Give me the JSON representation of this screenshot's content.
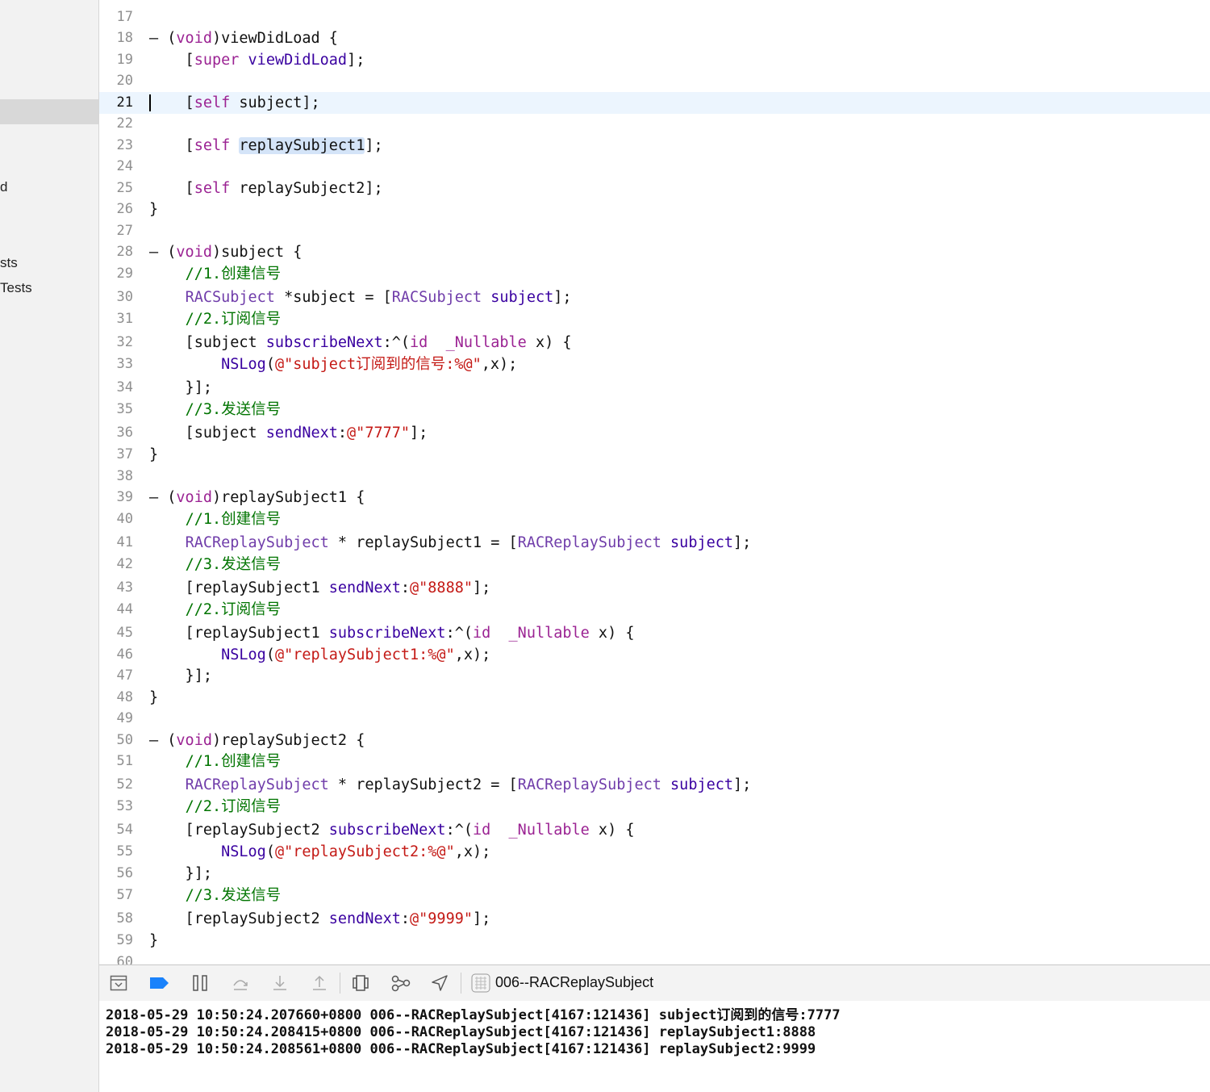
{
  "sidebar": {
    "items": [
      {
        "label": "d"
      },
      {
        "label": "sts"
      },
      {
        "label": "Tests"
      }
    ]
  },
  "editor": {
    "current_line": 21,
    "lines": [
      {
        "n": "17",
        "tokens": []
      },
      {
        "n": "18",
        "tokens": [
          {
            "t": "– ("
          },
          {
            "t": "void",
            "c": "kw"
          },
          {
            "t": ")viewDidLoad {"
          }
        ]
      },
      {
        "n": "19",
        "tokens": [
          {
            "t": "    ["
          },
          {
            "t": "super",
            "c": "kw"
          },
          {
            "t": " "
          },
          {
            "t": "viewDidLoad",
            "c": "m"
          },
          {
            "t": "];"
          }
        ]
      },
      {
        "n": "20",
        "tokens": []
      },
      {
        "n": "21",
        "tokens": [
          {
            "t": "    ["
          },
          {
            "t": "self",
            "c": "kw"
          },
          {
            "t": " subject];"
          }
        ]
      },
      {
        "n": "22",
        "tokens": []
      },
      {
        "n": "23",
        "tokens": [
          {
            "t": "    ["
          },
          {
            "t": "self",
            "c": "kw"
          },
          {
            "t": " "
          },
          {
            "t": "replaySubject1",
            "c": "hl"
          },
          {
            "t": "];"
          }
        ]
      },
      {
        "n": "24",
        "tokens": []
      },
      {
        "n": "25",
        "tokens": [
          {
            "t": "    ["
          },
          {
            "t": "self",
            "c": "kw"
          },
          {
            "t": " replaySubject2];"
          }
        ]
      },
      {
        "n": "26",
        "tokens": [
          {
            "t": "}"
          }
        ]
      },
      {
        "n": "27",
        "tokens": []
      },
      {
        "n": "28",
        "tokens": [
          {
            "t": "– ("
          },
          {
            "t": "void",
            "c": "kw"
          },
          {
            "t": ")subject {"
          }
        ]
      },
      {
        "n": "29",
        "tokens": [
          {
            "t": "    "
          },
          {
            "t": "//1.创建信号",
            "c": "cm"
          }
        ]
      },
      {
        "n": "30",
        "tokens": [
          {
            "t": "    "
          },
          {
            "t": "RACSubject",
            "c": "cls"
          },
          {
            "t": " *subject = ["
          },
          {
            "t": "RACSubject",
            "c": "cls"
          },
          {
            "t": " "
          },
          {
            "t": "subject",
            "c": "m"
          },
          {
            "t": "];"
          }
        ]
      },
      {
        "n": "31",
        "tokens": [
          {
            "t": "    "
          },
          {
            "t": "//2.订阅信号",
            "c": "cm"
          }
        ]
      },
      {
        "n": "32",
        "tokens": [
          {
            "t": "    [subject "
          },
          {
            "t": "subscribeNext",
            "c": "m"
          },
          {
            "t": ":^("
          },
          {
            "t": "id",
            "c": "kw"
          },
          {
            "t": "  "
          },
          {
            "t": "_Nullable",
            "c": "kw"
          },
          {
            "t": " x) {"
          }
        ]
      },
      {
        "n": "33",
        "tokens": [
          {
            "t": "        "
          },
          {
            "t": "NSLog",
            "c": "m"
          },
          {
            "t": "("
          },
          {
            "t": "@\"subject订阅到的信号:%@\"",
            "c": "str"
          },
          {
            "t": ",x);"
          }
        ]
      },
      {
        "n": "34",
        "tokens": [
          {
            "t": "    }];"
          }
        ]
      },
      {
        "n": "35",
        "tokens": [
          {
            "t": "    "
          },
          {
            "t": "//3.发送信号",
            "c": "cm"
          }
        ]
      },
      {
        "n": "36",
        "tokens": [
          {
            "t": "    [subject "
          },
          {
            "t": "sendNext",
            "c": "m"
          },
          {
            "t": ":"
          },
          {
            "t": "@\"7777\"",
            "c": "str"
          },
          {
            "t": "];"
          }
        ]
      },
      {
        "n": "37",
        "tokens": [
          {
            "t": "}"
          }
        ]
      },
      {
        "n": "38",
        "tokens": []
      },
      {
        "n": "39",
        "tokens": [
          {
            "t": "– ("
          },
          {
            "t": "void",
            "c": "kw"
          },
          {
            "t": ")replaySubject1 {"
          }
        ]
      },
      {
        "n": "40",
        "tokens": [
          {
            "t": "    "
          },
          {
            "t": "//1.创建信号",
            "c": "cm"
          }
        ]
      },
      {
        "n": "41",
        "tokens": [
          {
            "t": "    "
          },
          {
            "t": "RACReplaySubject",
            "c": "cls"
          },
          {
            "t": " * replaySubject1 = ["
          },
          {
            "t": "RACReplaySubject",
            "c": "cls"
          },
          {
            "t": " "
          },
          {
            "t": "subject",
            "c": "m"
          },
          {
            "t": "];"
          }
        ]
      },
      {
        "n": "42",
        "tokens": [
          {
            "t": "    "
          },
          {
            "t": "//3.发送信号",
            "c": "cm"
          }
        ]
      },
      {
        "n": "43",
        "tokens": [
          {
            "t": "    [replaySubject1 "
          },
          {
            "t": "sendNext",
            "c": "m"
          },
          {
            "t": ":"
          },
          {
            "t": "@\"8888\"",
            "c": "str"
          },
          {
            "t": "];"
          }
        ]
      },
      {
        "n": "44",
        "tokens": [
          {
            "t": "    "
          },
          {
            "t": "//2.订阅信号",
            "c": "cm"
          }
        ]
      },
      {
        "n": "45",
        "tokens": [
          {
            "t": "    [replaySubject1 "
          },
          {
            "t": "subscribeNext",
            "c": "m"
          },
          {
            "t": ":^("
          },
          {
            "t": "id",
            "c": "kw"
          },
          {
            "t": "  "
          },
          {
            "t": "_Nullable",
            "c": "kw"
          },
          {
            "t": " x) {"
          }
        ]
      },
      {
        "n": "46",
        "tokens": [
          {
            "t": "        "
          },
          {
            "t": "NSLog",
            "c": "m"
          },
          {
            "t": "("
          },
          {
            "t": "@\"replaySubject1:%@\"",
            "c": "str"
          },
          {
            "t": ",x);"
          }
        ]
      },
      {
        "n": "47",
        "tokens": [
          {
            "t": "    }];"
          }
        ]
      },
      {
        "n": "48",
        "tokens": [
          {
            "t": "}"
          }
        ]
      },
      {
        "n": "49",
        "tokens": []
      },
      {
        "n": "50",
        "tokens": [
          {
            "t": "– ("
          },
          {
            "t": "void",
            "c": "kw"
          },
          {
            "t": ")replaySubject2 {"
          }
        ]
      },
      {
        "n": "51",
        "tokens": [
          {
            "t": "    "
          },
          {
            "t": "//1.创建信号",
            "c": "cm"
          }
        ]
      },
      {
        "n": "52",
        "tokens": [
          {
            "t": "    "
          },
          {
            "t": "RACReplaySubject",
            "c": "cls"
          },
          {
            "t": " * replaySubject2 = ["
          },
          {
            "t": "RACReplaySubject",
            "c": "cls"
          },
          {
            "t": " "
          },
          {
            "t": "subject",
            "c": "m"
          },
          {
            "t": "];"
          }
        ]
      },
      {
        "n": "53",
        "tokens": [
          {
            "t": "    "
          },
          {
            "t": "//2.订阅信号",
            "c": "cm"
          }
        ]
      },
      {
        "n": "54",
        "tokens": [
          {
            "t": "    [replaySubject2 "
          },
          {
            "t": "subscribeNext",
            "c": "m"
          },
          {
            "t": ":^("
          },
          {
            "t": "id",
            "c": "kw"
          },
          {
            "t": "  "
          },
          {
            "t": "_Nullable",
            "c": "kw"
          },
          {
            "t": " x) {"
          }
        ]
      },
      {
        "n": "55",
        "tokens": [
          {
            "t": "        "
          },
          {
            "t": "NSLog",
            "c": "m"
          },
          {
            "t": "("
          },
          {
            "t": "@\"replaySubject2:%@\"",
            "c": "str"
          },
          {
            "t": ",x);"
          }
        ]
      },
      {
        "n": "56",
        "tokens": [
          {
            "t": "    }];"
          }
        ]
      },
      {
        "n": "57",
        "tokens": [
          {
            "t": "    "
          },
          {
            "t": "//3.发送信号",
            "c": "cm"
          }
        ]
      },
      {
        "n": "58",
        "tokens": [
          {
            "t": "    [replaySubject2 "
          },
          {
            "t": "sendNext",
            "c": "m"
          },
          {
            "t": ":"
          },
          {
            "t": "@\"9999\"",
            "c": "str"
          },
          {
            "t": "];"
          }
        ]
      },
      {
        "n": "59",
        "tokens": [
          {
            "t": "}"
          }
        ]
      },
      {
        "n": "60",
        "tokens": []
      }
    ]
  },
  "debug_bar": {
    "buttons": [
      {
        "name": "hide-debug-area-icon"
      },
      {
        "name": "breakpoints-toggle-icon"
      },
      {
        "name": "pause-icon"
      },
      {
        "name": "step-over-icon"
      },
      {
        "name": "step-into-icon"
      },
      {
        "name": "step-out-icon"
      },
      {
        "name": "view-hierarchy-icon"
      },
      {
        "name": "memory-graph-icon"
      },
      {
        "name": "simulate-location-icon"
      }
    ],
    "target_label": "006--RACReplaySubject",
    "accent": "#1a82fb"
  },
  "console": {
    "lines": [
      "2018-05-29 10:50:24.207660+0800 006--RACReplaySubject[4167:121436] subject订阅到的信号:7777",
      "2018-05-29 10:50:24.208415+0800 006--RACReplaySubject[4167:121436] replaySubject1:8888",
      "2018-05-29 10:50:24.208561+0800 006--RACReplaySubject[4167:121436] replaySubject2:9999"
    ]
  },
  "colors": {
    "keyword": "#9b2393",
    "class": "#703daa",
    "method": "#3900a0",
    "string": "#c41a16",
    "comment": "#007400",
    "current_line_bg": "#ecf5fe"
  }
}
